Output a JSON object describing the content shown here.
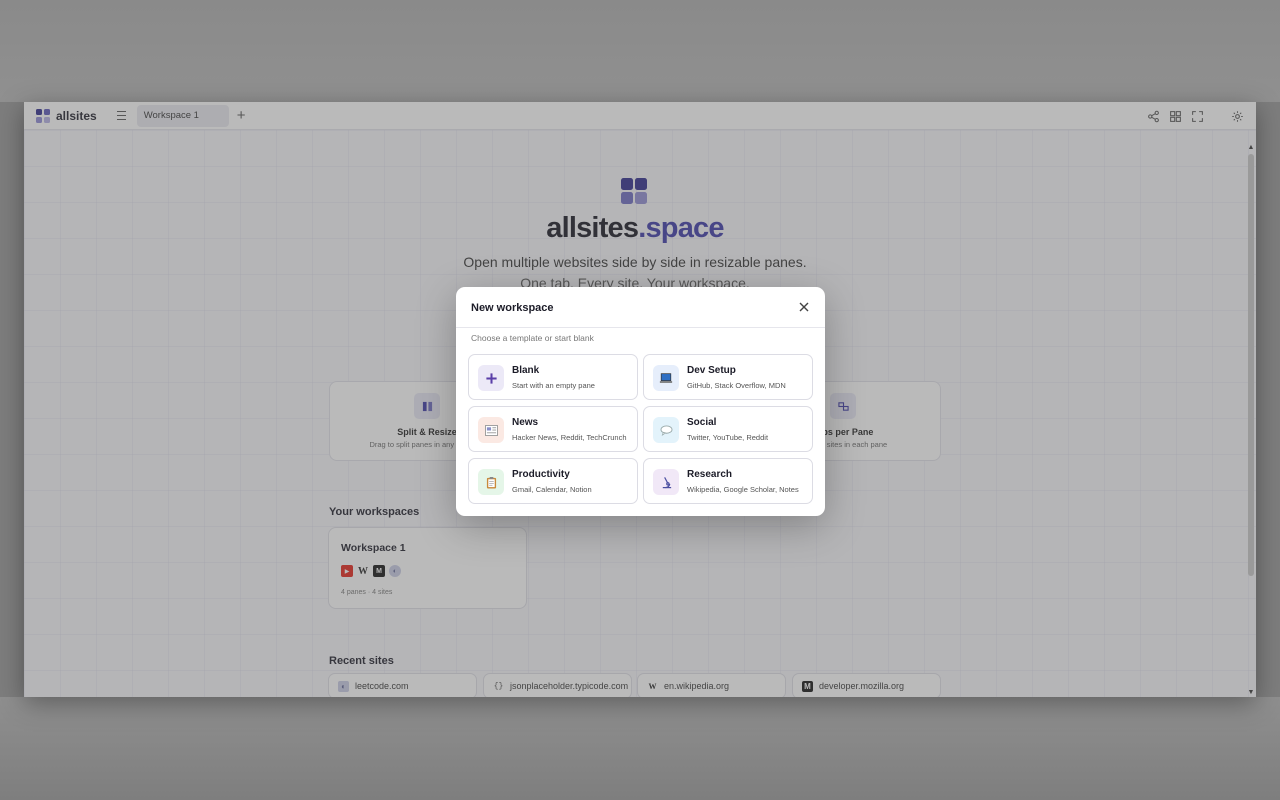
{
  "app": {
    "logo_text": "allsites",
    "tab_label": "Workspace 1",
    "add_tab_icon": "plus-icon",
    "menu_icon": "hamburger-icon",
    "right_icons": [
      "share-icon",
      "grid-layout-icon",
      "fullscreen-icon",
      "gear-icon"
    ]
  },
  "hero": {
    "title_main": "allsites",
    "title_accent": ".space",
    "subtitle1": "Open multiple websites side by side in resizable panes.",
    "subtitle2": "One tab. Every site. Your workspace."
  },
  "features": [
    {
      "title": "Split & Resize",
      "desc": "Drag to split panes in any direction"
    },
    {
      "title": "Tabs per Pane",
      "desc": "Multiple sites in each pane"
    }
  ],
  "workspaces_section": {
    "title": "Your workspaces",
    "card": {
      "name": "Workspace 1",
      "meta": "4 panes  ·  4 sites"
    }
  },
  "recent_section": {
    "title": "Recent sites",
    "sites": [
      "leetcode.com",
      "jsonplaceholder.typicode.com",
      "en.wikipedia.org",
      "developer.mozilla.org"
    ]
  },
  "modal": {
    "title": "New workspace",
    "subtitle": "Choose a template or start blank",
    "templates": [
      {
        "name": "Blank",
        "desc": "Start with an empty pane",
        "icon": "plus-icon"
      },
      {
        "name": "Dev Setup",
        "desc": "GitHub, Stack Overflow, MDN",
        "icon": "laptop-icon"
      },
      {
        "name": "News",
        "desc": "Hacker News, Reddit, TechCrunch",
        "icon": "newspaper-icon"
      },
      {
        "name": "Social",
        "desc": "Twitter, YouTube, Reddit",
        "icon": "speech-bubble-icon"
      },
      {
        "name": "Productivity",
        "desc": "Gmail, Calendar, Notion",
        "icon": "clipboard-icon"
      },
      {
        "name": "Research",
        "desc": "Wikipedia, Google Scholar, Notes",
        "icon": "microscope-icon"
      }
    ]
  },
  "colors": {
    "brand": "#2d2a8c",
    "accent": "#3b38a8",
    "overlay": "rgba(90,90,90,0.42)"
  }
}
